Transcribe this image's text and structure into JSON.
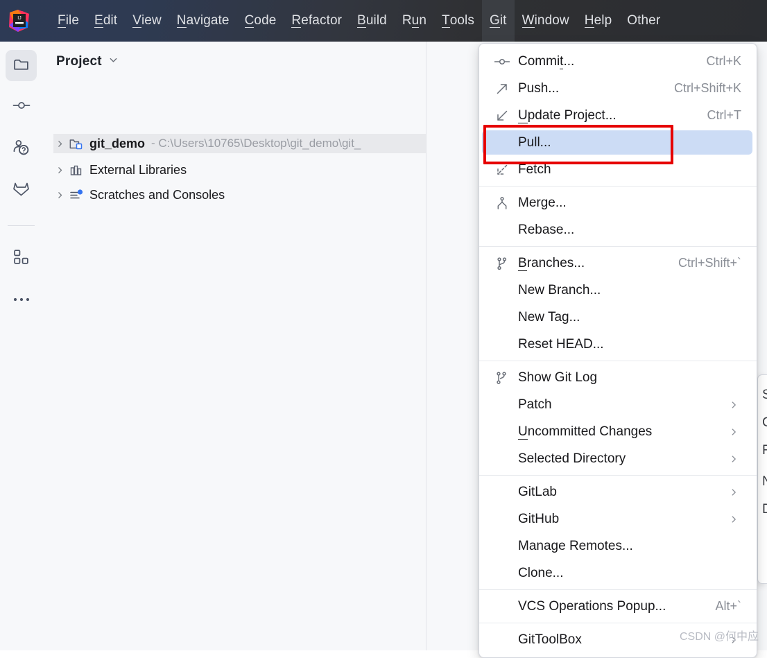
{
  "app": {
    "logo_icon": "intellij-idea-logo"
  },
  "menubar": {
    "items": [
      {
        "label": "File",
        "mnemonic": "F",
        "rest": "ile"
      },
      {
        "label": "Edit",
        "mnemonic": "E",
        "rest": "dit"
      },
      {
        "label": "View",
        "mnemonic": "V",
        "rest": "iew"
      },
      {
        "label": "Navigate",
        "mnemonic": "N",
        "rest": "avigate"
      },
      {
        "label": "Code",
        "mnemonic": "C",
        "rest": "ode"
      },
      {
        "label": "Refactor",
        "mnemonic": "R",
        "rest": "efactor"
      },
      {
        "label": "Build",
        "mnemonic": "B",
        "rest": "uild"
      },
      {
        "label": "Run",
        "mnemonic": "R",
        "rest": "un",
        "mnemonic_index": 2
      },
      {
        "label": "Tools",
        "mnemonic": "T",
        "rest": "ools"
      },
      {
        "label": "Git",
        "mnemonic": "G",
        "rest": "it",
        "active": true
      },
      {
        "label": "Window",
        "mnemonic": "W",
        "rest": "indow"
      },
      {
        "label": "Help",
        "mnemonic": "H",
        "rest": "elp"
      },
      {
        "label": "Other",
        "mnemonic": "",
        "rest": "Other"
      }
    ]
  },
  "toolstripe": {
    "buttons": [
      {
        "name": "project-tool-button",
        "icon": "folder-icon",
        "selected": true
      },
      {
        "name": "commit-tool-button",
        "icon": "commit-node-icon",
        "selected": false
      },
      {
        "name": "pull-requests-tool-button",
        "icon": "pull-request-icon",
        "selected": false
      },
      {
        "name": "gitlab-tool-button",
        "icon": "gitlab-fox-icon",
        "selected": false
      },
      {
        "name": "structure-tool-button",
        "icon": "blocks-icon",
        "selected": false
      },
      {
        "name": "more-tool-button",
        "icon": "more-dots-icon",
        "selected": false
      }
    ]
  },
  "project_panel": {
    "title": "Project",
    "dropdown_icon": "chevron-down-icon",
    "tree": [
      {
        "label": "git_demo",
        "path": "- C:\\Users\\10765\\Desktop\\git_demo\\git_",
        "icon": "module-folder-icon",
        "bold": true,
        "selected": true,
        "expanded": false
      },
      {
        "label": "External Libraries",
        "path": "",
        "icon": "libraries-icon",
        "bold": false,
        "selected": false,
        "expanded": false
      },
      {
        "label": "Scratches and Consoles",
        "path": "",
        "icon": "scratches-icon",
        "bold": false,
        "selected": false,
        "expanded": false
      }
    ]
  },
  "git_menu": {
    "groups": [
      {
        "items": [
          {
            "label": "Commit...",
            "mn": "t",
            "pre": "Commi",
            "post": "...",
            "shortcut": "Ctrl+K",
            "icon": "commit-icon",
            "arrow": false,
            "highlight": false
          },
          {
            "label": "Push...",
            "mn": "",
            "pre": "Push...",
            "post": "",
            "shortcut": "Ctrl+Shift+K",
            "icon": "push-icon",
            "arrow": false,
            "highlight": false
          },
          {
            "label": "Update Project...",
            "mn": "U",
            "pre": "",
            "post": "pdate Project...",
            "shortcut": "Ctrl+T",
            "icon": "update-icon",
            "arrow": false,
            "highlight": false
          },
          {
            "label": "Pull...",
            "mn": "",
            "pre": "Pull...",
            "post": "",
            "shortcut": "",
            "icon": "",
            "arrow": false,
            "highlight": true
          },
          {
            "label": "Fetch",
            "mn": "",
            "pre": "Fetch",
            "post": "",
            "shortcut": "",
            "icon": "fetch-icon",
            "arrow": false,
            "highlight": false
          }
        ]
      },
      {
        "items": [
          {
            "label": "Merge...",
            "mn": "",
            "pre": "Merge...",
            "post": "",
            "shortcut": "",
            "icon": "merge-icon",
            "arrow": false,
            "highlight": false
          },
          {
            "label": "Rebase...",
            "mn": "",
            "pre": "Rebase...",
            "post": "",
            "shortcut": "",
            "icon": "",
            "arrow": false,
            "highlight": false
          }
        ]
      },
      {
        "items": [
          {
            "label": "Branches...",
            "mn": "B",
            "pre": "",
            "post": "ranches...",
            "shortcut": "Ctrl+Shift+`",
            "icon": "branch-icon",
            "arrow": false,
            "highlight": false
          },
          {
            "label": "New Branch...",
            "mn": "",
            "pre": "New Branch...",
            "post": "",
            "shortcut": "",
            "icon": "",
            "arrow": false,
            "highlight": false
          },
          {
            "label": "New Tag...",
            "mn": "",
            "pre": "New Tag...",
            "post": "",
            "shortcut": "",
            "icon": "",
            "arrow": false,
            "highlight": false
          },
          {
            "label": "Reset HEAD...",
            "mn": "",
            "pre": "Reset HEAD...",
            "post": "",
            "shortcut": "",
            "icon": "",
            "arrow": false,
            "highlight": false
          }
        ]
      },
      {
        "items": [
          {
            "label": "Show Git Log",
            "mn": "",
            "pre": "Show Git Log",
            "post": "",
            "shortcut": "",
            "icon": "git-log-icon",
            "arrow": false,
            "highlight": false
          },
          {
            "label": "Patch",
            "mn": "",
            "pre": "Patch",
            "post": "",
            "shortcut": "",
            "icon": "",
            "arrow": true,
            "highlight": false
          },
          {
            "label": "Uncommitted Changes",
            "mn": "U",
            "pre": "",
            "post": "ncommitted Changes",
            "shortcut": "",
            "icon": "",
            "arrow": true,
            "highlight": false
          },
          {
            "label": "Selected Directory",
            "mn": "",
            "pre": "Selected Directory",
            "post": "",
            "shortcut": "",
            "icon": "",
            "arrow": true,
            "highlight": false
          }
        ]
      },
      {
        "items": [
          {
            "label": "GitLab",
            "mn": "",
            "pre": "GitLab",
            "post": "",
            "shortcut": "",
            "icon": "",
            "arrow": true,
            "highlight": false
          },
          {
            "label": "GitHub",
            "mn": "",
            "pre": "GitHub",
            "post": "",
            "shortcut": "",
            "icon": "",
            "arrow": true,
            "highlight": false
          },
          {
            "label": "Manage Remotes...",
            "mn": "",
            "pre": "Manage Remotes...",
            "post": "",
            "shortcut": "",
            "icon": "",
            "arrow": false,
            "highlight": false
          },
          {
            "label": "Clone...",
            "mn": "",
            "pre": "Clone...",
            "post": "",
            "shortcut": "",
            "icon": "",
            "arrow": false,
            "highlight": false
          }
        ]
      },
      {
        "items": [
          {
            "label": "VCS Operations Popup...",
            "mn": "",
            "pre": "VCS Operations Popup...",
            "post": "",
            "shortcut": "Alt+`",
            "icon": "",
            "arrow": false,
            "highlight": false
          }
        ]
      },
      {
        "items": [
          {
            "label": "GitToolBox",
            "mn": "",
            "pre": "GitToolBox",
            "post": "",
            "shortcut": "",
            "icon": "",
            "arrow": true,
            "highlight": false
          }
        ]
      }
    ]
  },
  "right_peek_menu": {
    "rows": [
      "S",
      "C",
      "F",
      "N",
      "D"
    ]
  },
  "annotation": {
    "target": "Pull...",
    "color": "#e60000"
  },
  "watermark": {
    "text": "CSDN @何中应"
  },
  "colors": {
    "menubar_dark": "#2b2d31",
    "menubar_blue": "#2d3a55",
    "panel_bg": "#f7f8fa",
    "menu_bg": "#ffffff",
    "highlight_blue": "#ccdcf5",
    "selection_gray": "#e8e9ec",
    "annotation_red": "#e60000",
    "accent_blue": "#3574f0"
  }
}
